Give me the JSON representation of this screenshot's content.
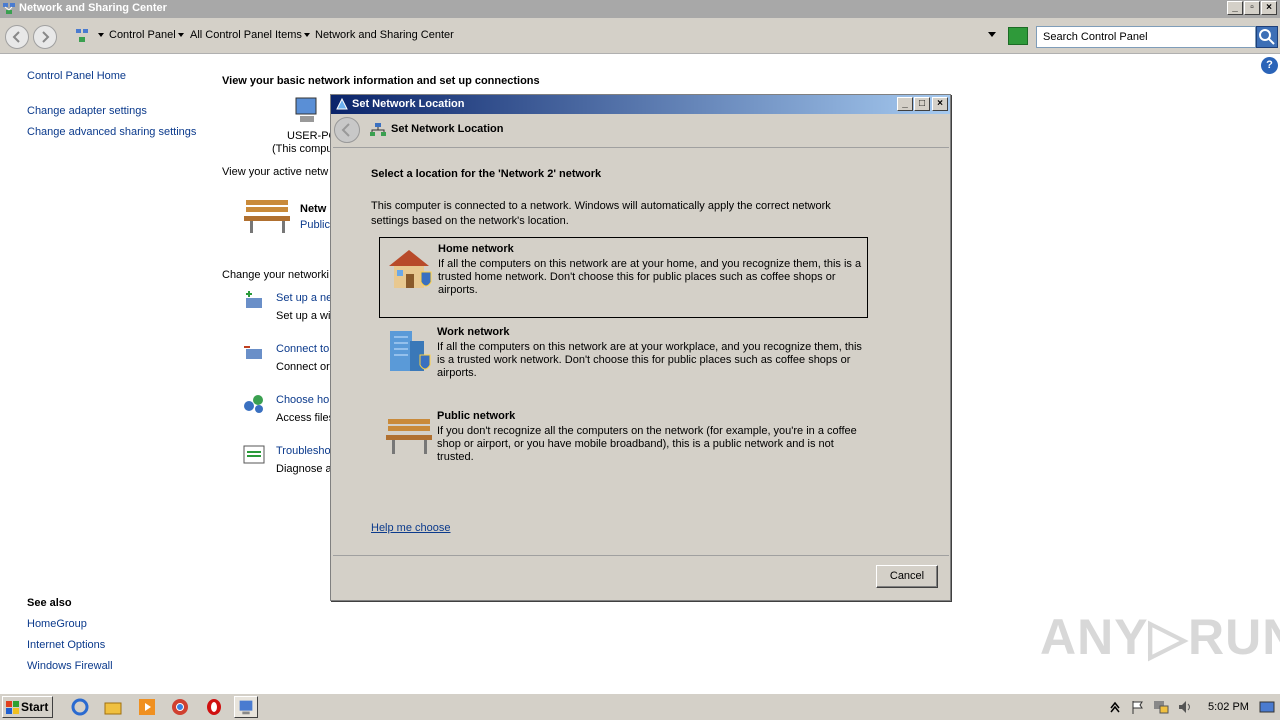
{
  "window": {
    "title": "Network and Sharing Center"
  },
  "addressbar": {
    "crumbs": [
      "Control Panel",
      "All Control Panel Items",
      "Network and Sharing Center"
    ],
    "search_placeholder": "Search Control Panel"
  },
  "sidebar": {
    "home": "Control Panel Home",
    "links": [
      "Change adapter settings",
      "Change advanced sharing settings"
    ],
    "see_also_title": "See also",
    "see_also": [
      "HomeGroup",
      "Internet Options",
      "Windows Firewall"
    ]
  },
  "main": {
    "heading": "View your basic network information and set up connections",
    "computer_name": "USER-PC",
    "computer_sub": "(This compu",
    "active_label": "View your active netw",
    "network_name": "Netw",
    "network_type": "Public",
    "change_label": "Change your networki",
    "tasks": [
      {
        "link": "Set up a ne",
        "desc": "Set up a wi"
      },
      {
        "link": "Connect to",
        "desc": "Connect or"
      },
      {
        "link": "Choose hor",
        "desc": "Access files"
      },
      {
        "link": "Troublesho",
        "desc": "Diagnose a"
      }
    ]
  },
  "dialog": {
    "title": "Set Network Location",
    "header": "Set Network Location",
    "question": "Select a location for the 'Network  2' network",
    "description": "This computer is connected to a network. Windows will automatically apply the correct network settings based on the network's location.",
    "options": [
      {
        "title": "Home network",
        "desc": "If all the computers on this network are at your home, and you recognize them, this is a trusted home network.  Don't choose this for public places such as coffee shops or airports."
      },
      {
        "title": "Work network",
        "desc": "If all the computers on this network are at your workplace, and you recognize them, this is a trusted work network.  Don't choose this for public places such as coffee shops or airports."
      },
      {
        "title": "Public network",
        "desc": "If you don't recognize all the computers on the network (for example, you're in a coffee shop or airport, or you have mobile broadband), this is a public network and is not trusted."
      }
    ],
    "help_link": "Help me choose",
    "cancel": "Cancel"
  },
  "taskbar": {
    "start": "Start",
    "clock": "5:02 PM"
  },
  "watermark": "ANY RUN"
}
